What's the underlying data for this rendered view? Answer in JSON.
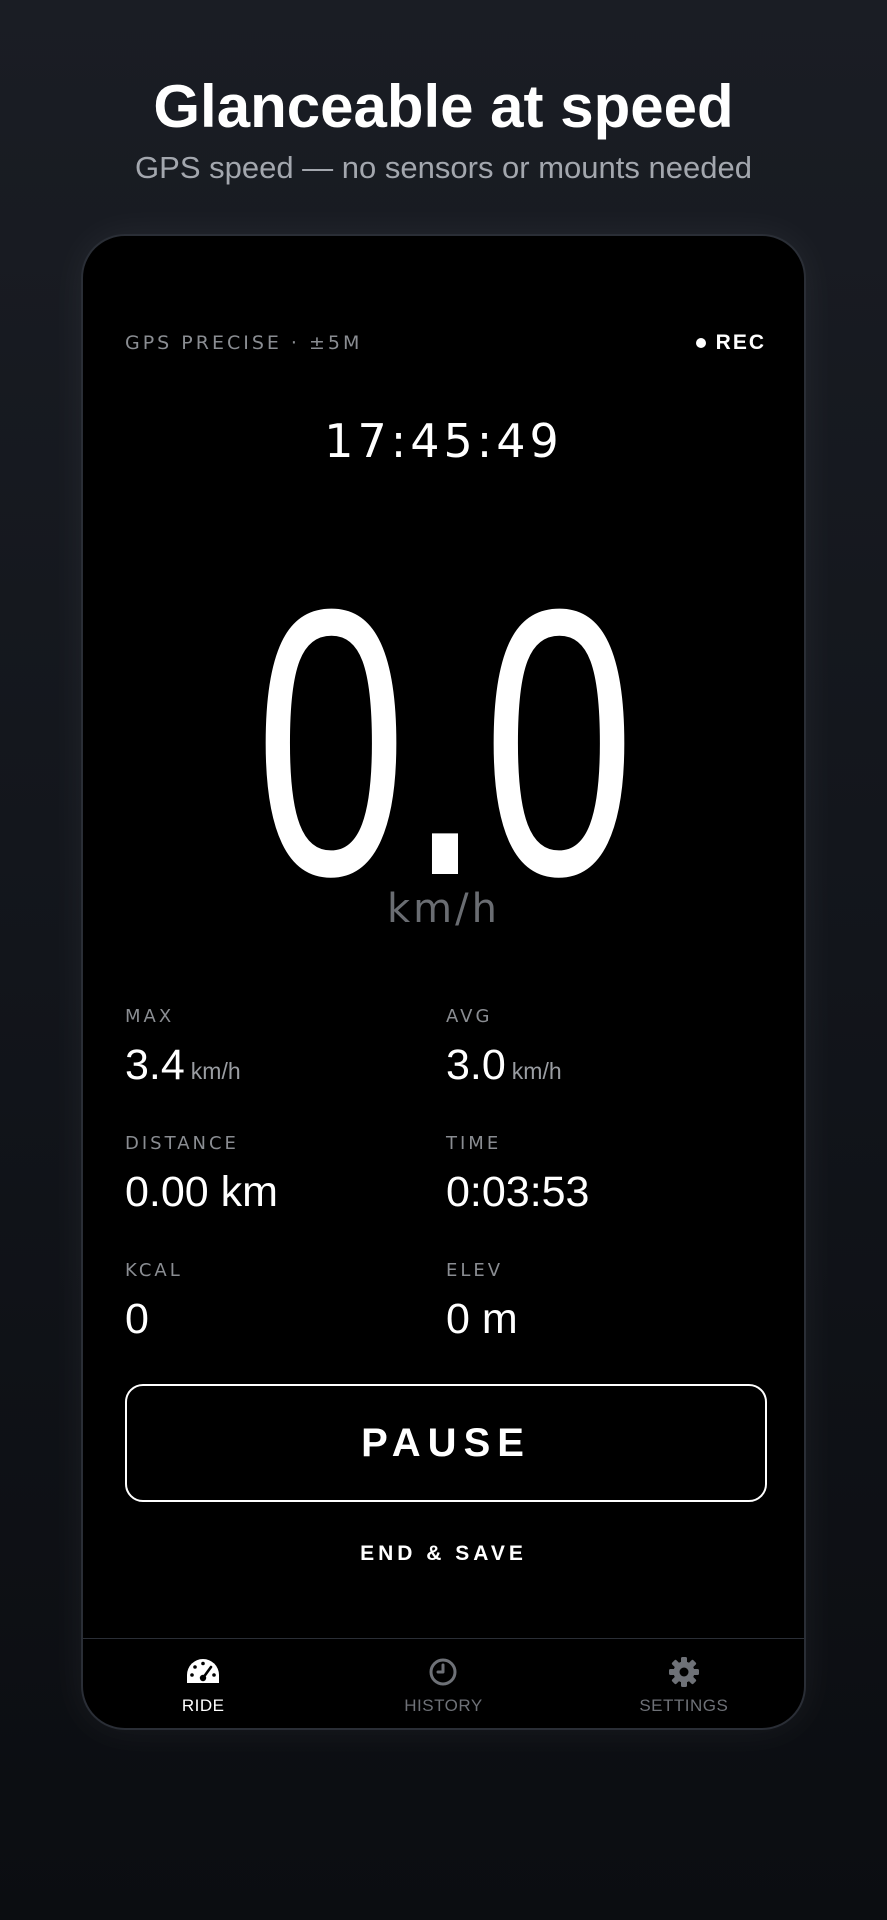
{
  "headline": "Glanceable at speed",
  "subheadline": "GPS speed — no sensors or mounts needed",
  "status": {
    "gps": "GPS PRECISE · ±5M",
    "rec": "REC"
  },
  "clock": "17:45:49",
  "speed": {
    "value": "0.0",
    "unit": "km/h"
  },
  "stats": [
    {
      "label": "MAX",
      "value": "3.4",
      "unit": "km/h"
    },
    {
      "label": "AVG",
      "value": "3.0",
      "unit": "km/h"
    },
    {
      "label": "DISTANCE",
      "value": "0.00 km",
      "unit": ""
    },
    {
      "label": "TIME",
      "value": "0:03:53",
      "unit": ""
    },
    {
      "label": "KCAL",
      "value": "0",
      "unit": ""
    },
    {
      "label": "ELEV",
      "value": "0 m",
      "unit": ""
    }
  ],
  "actions": {
    "pause": "PAUSE",
    "end_save": "END & SAVE"
  },
  "tabs": [
    {
      "label": "RIDE",
      "icon": "speedometer-icon",
      "active": true
    },
    {
      "label": "HISTORY",
      "icon": "clock-icon",
      "active": false
    },
    {
      "label": "SETTINGS",
      "icon": "gear-icon",
      "active": false
    }
  ],
  "colors": {
    "accent": "#ffffff",
    "muted": "#8a8d92",
    "background": "#000000"
  }
}
